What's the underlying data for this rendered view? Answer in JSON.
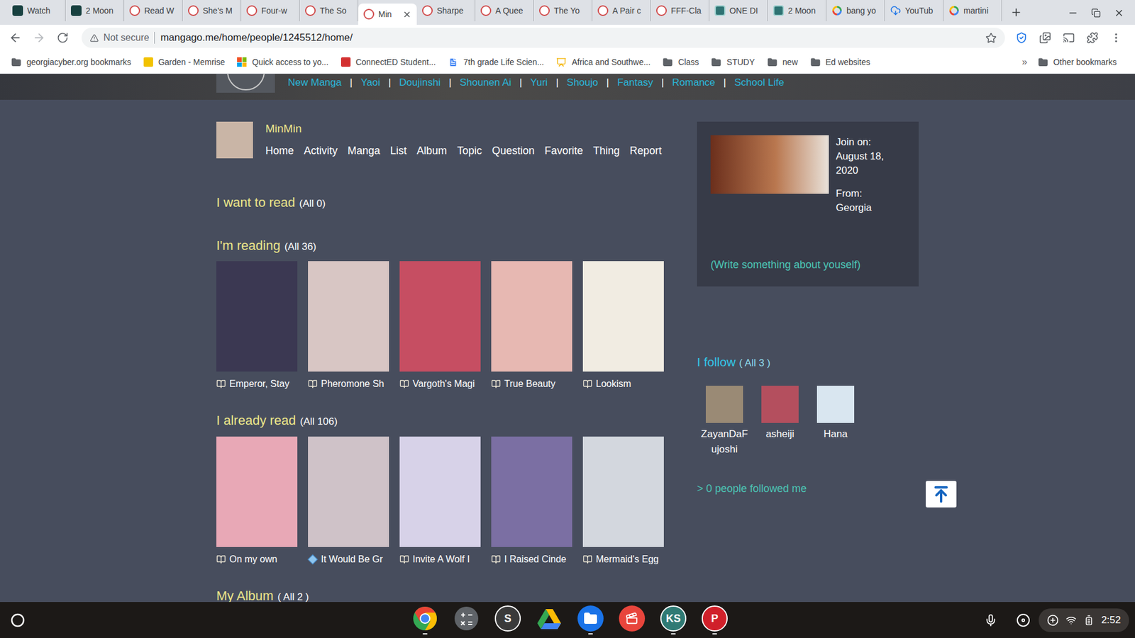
{
  "browser": {
    "tabs": [
      {
        "label": "Watch",
        "kind": "series",
        "selected": false
      },
      {
        "label": "2 Moon",
        "kind": "series",
        "selected": false
      },
      {
        "label": "Read W",
        "kind": "mangago",
        "selected": false
      },
      {
        "label": "She's M",
        "kind": "mangago",
        "selected": false
      },
      {
        "label": "Four-w",
        "kind": "mangago",
        "selected": false
      },
      {
        "label": "The So",
        "kind": "mangago",
        "selected": false
      },
      {
        "label": "Min",
        "kind": "mangago",
        "selected": true
      },
      {
        "label": "Sharpe",
        "kind": "mangago",
        "selected": false
      },
      {
        "label": "A Quee",
        "kind": "mangago",
        "selected": false
      },
      {
        "label": "The Yo",
        "kind": "mangago",
        "selected": false
      },
      {
        "label": "A Pair c",
        "kind": "mangago",
        "selected": false
      },
      {
        "label": "FFF-Cla",
        "kind": "mangago",
        "selected": false
      },
      {
        "label": "ONE DI",
        "kind": "drama",
        "selected": false
      },
      {
        "label": "2 Moon",
        "kind": "drama",
        "selected": false
      },
      {
        "label": "bang yo",
        "kind": "google",
        "selected": false
      },
      {
        "label": "YouTub",
        "kind": "cloud",
        "selected": false
      },
      {
        "label": "martini",
        "kind": "google",
        "selected": false
      }
    ],
    "address": {
      "security": "Not secure",
      "url": "mangago.me/home/people/1245512/home/"
    },
    "bookmarks": [
      {
        "label": "georgiacyber.org bookmarks",
        "kind": "folder"
      },
      {
        "label": "Garden - Memrise",
        "kind": "site",
        "color": "#f2c200"
      },
      {
        "label": "Quick access to yo...",
        "kind": "ms"
      },
      {
        "label": "ConnectED Student...",
        "kind": "site",
        "color": "#d32f2f"
      },
      {
        "label": "7th grade Life Scien...",
        "kind": "doc"
      },
      {
        "label": "Africa and Southwe...",
        "kind": "slides"
      },
      {
        "label": "Class",
        "kind": "folder"
      },
      {
        "label": "STUDY",
        "kind": "folder"
      },
      {
        "label": "new",
        "kind": "folder"
      },
      {
        "label": "Ed websites",
        "kind": "folder"
      }
    ],
    "bookmarks_overflow": "»",
    "other_bookmarks": "Other bookmarks"
  },
  "site_nav": {
    "separator": "|",
    "links": [
      "New Manga",
      "Yaoi",
      "Doujinshi",
      "Shounen Ai",
      "Yuri",
      "Shoujo",
      "Fantasy",
      "Romance",
      "School Life"
    ]
  },
  "profile": {
    "name": "MinMin",
    "menu": [
      "Home",
      "Activity",
      "Manga",
      "List",
      "Album",
      "Topic",
      "Question",
      "Favorite",
      "Thing",
      "Report"
    ]
  },
  "sections": [
    {
      "title": "I want to read",
      "count": "(All 0)",
      "items": []
    },
    {
      "title": "I'm reading",
      "count": "(All 36)",
      "items": [
        {
          "title": "Emperor, Stay",
          "kind": "book",
          "color": "#3b3852"
        },
        {
          "title": "Pheromone Sh",
          "kind": "book",
          "color": "#d8c6c4"
        },
        {
          "title": "Vargoth's Magi",
          "kind": "book",
          "color": "#c64e62"
        },
        {
          "title": "True Beauty",
          "kind": "book",
          "color": "#e7b8b2"
        },
        {
          "title": "Lookism",
          "kind": "book",
          "color": "#f1ece2"
        }
      ]
    },
    {
      "title": "I already read",
      "count": "(All 106)",
      "items": [
        {
          "title": "On my own",
          "kind": "book",
          "color": "#e8a8b6"
        },
        {
          "title": "It Would Be Gr",
          "kind": "tag",
          "color": "#cfc2c8"
        },
        {
          "title": "Invite A Wolf I",
          "kind": "book",
          "color": "#d7d2e8"
        },
        {
          "title": "I Raised Cinde",
          "kind": "book",
          "color": "#7b6fa3"
        },
        {
          "title": "Mermaid's Egg",
          "kind": "book",
          "color": "#d3d7de"
        }
      ]
    },
    {
      "title": "My Album",
      "count": "( All 2 )",
      "items": []
    }
  ],
  "info": {
    "join_label": "Join on:",
    "join_date": "August 18, 2020",
    "from_label": "From:",
    "from": "Georgia",
    "about_link": "(Write something about youself)"
  },
  "following": {
    "title": "I follow",
    "count": "( All 3 )",
    "users": [
      {
        "name": "ZayanDaFujoshi",
        "color": "#9a8a75"
      },
      {
        "name": "asheiji",
        "color": "#b44f5e"
      },
      {
        "name": "Hana",
        "color": "#d9e6f0"
      }
    ],
    "followers_link": "> 0 people followed me"
  },
  "shelf": {
    "apps": [
      {
        "kind": "chrome",
        "running": true
      },
      {
        "kind": "calculator",
        "running": false
      },
      {
        "kind": "glyph",
        "glyph": "S",
        "color": "#3a3a3a",
        "running": false
      },
      {
        "kind": "drive",
        "running": false
      },
      {
        "kind": "files",
        "running": true
      },
      {
        "kind": "screencast",
        "running": false
      },
      {
        "kind": "glyph",
        "glyph": "KS",
        "color": "#2f7a74",
        "running": true
      },
      {
        "kind": "glyph",
        "glyph": "P",
        "color": "#d0202a",
        "running": true
      }
    ],
    "time": "2:52"
  }
}
